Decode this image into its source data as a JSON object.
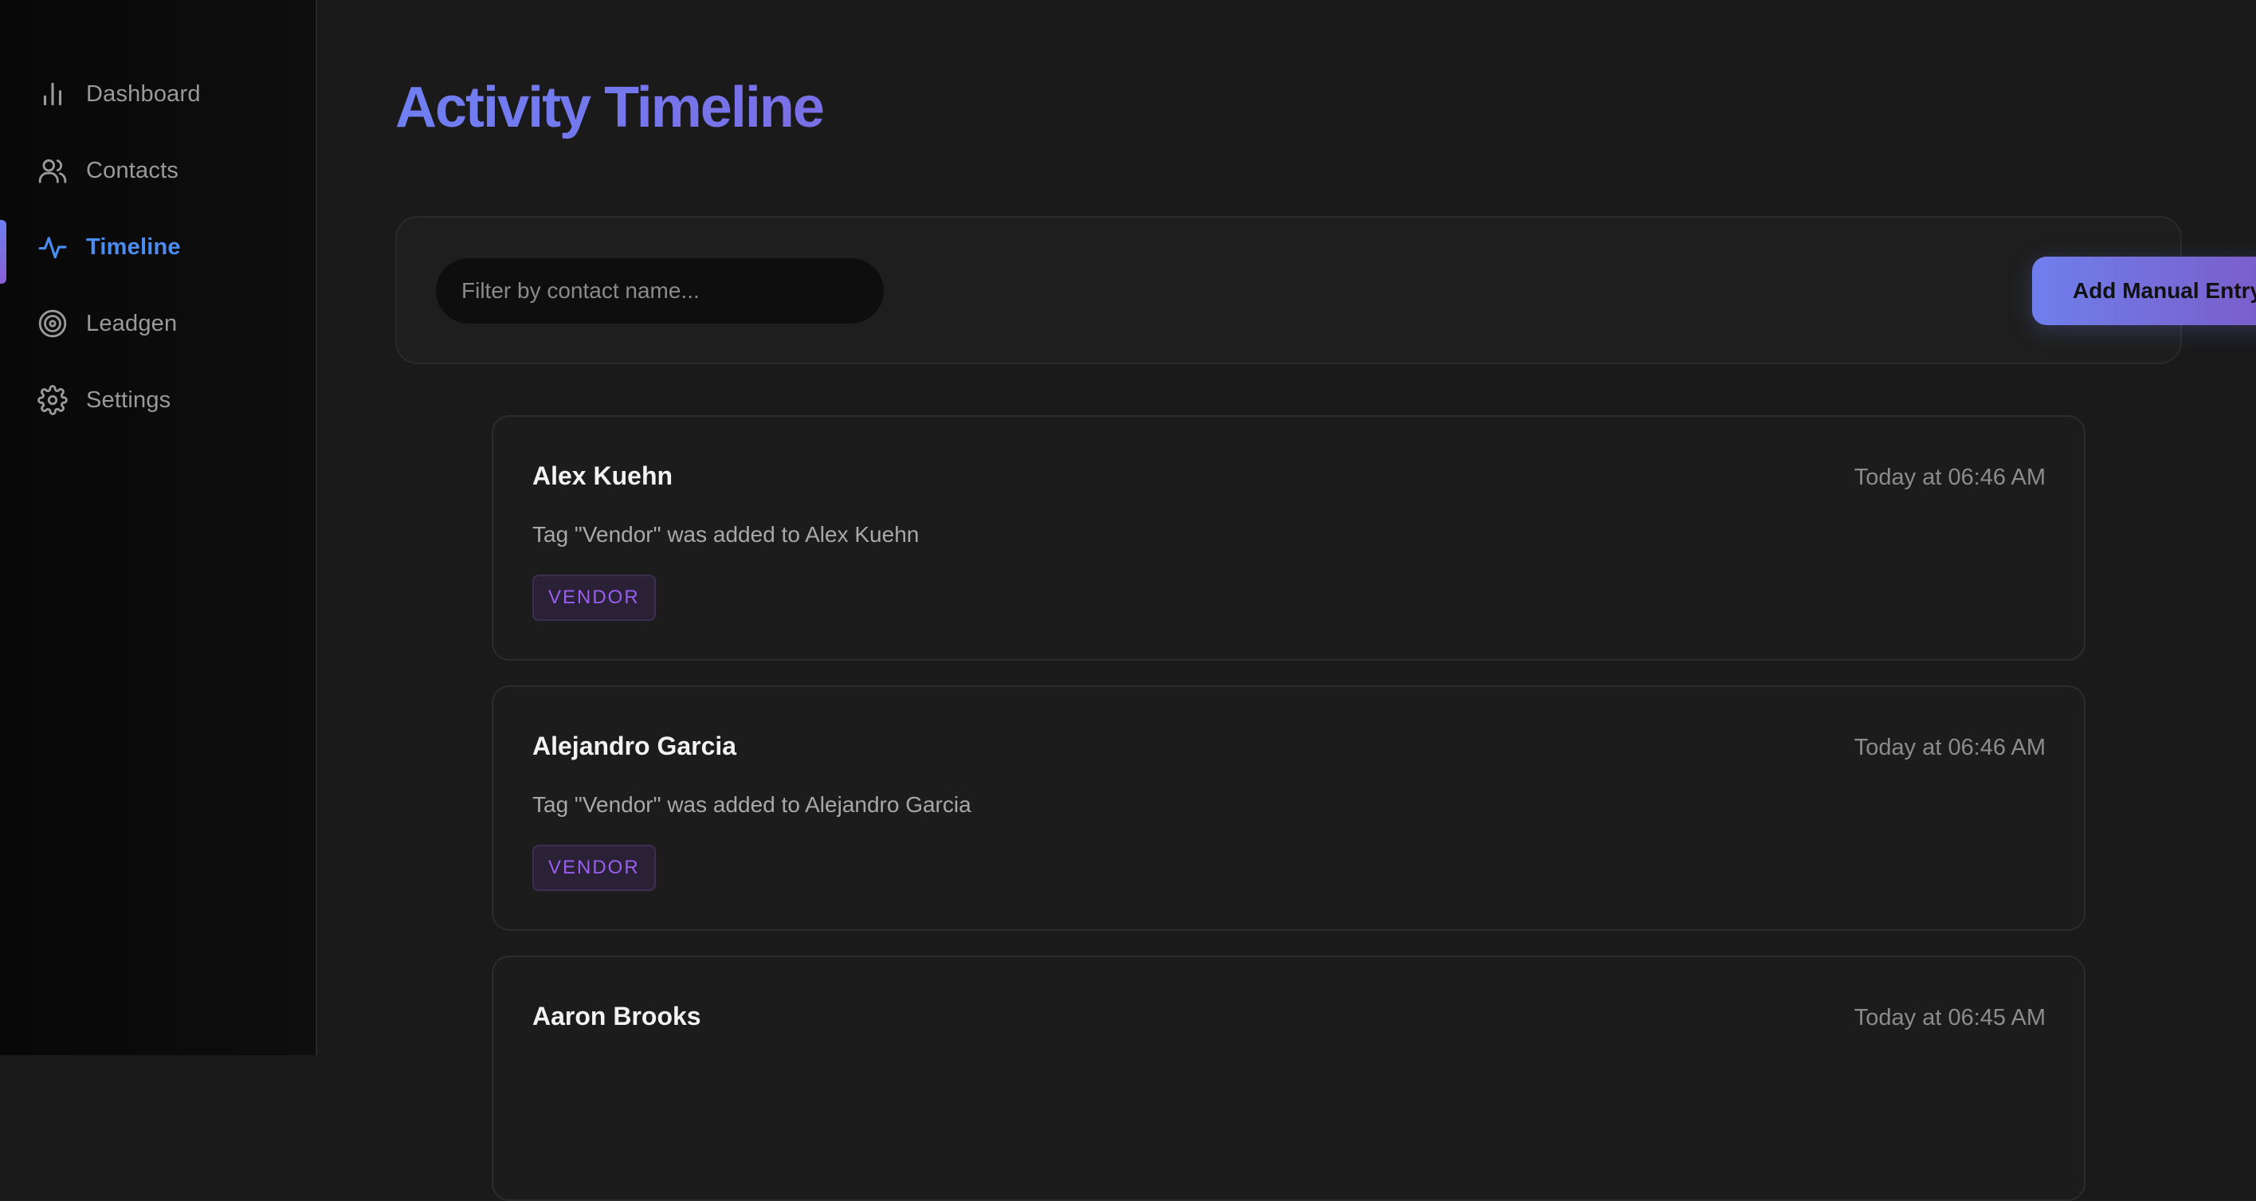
{
  "sidebar": {
    "items": [
      {
        "label": "Dashboard",
        "icon": "bar-chart-icon",
        "active": false
      },
      {
        "label": "Contacts",
        "icon": "users-icon",
        "active": false
      },
      {
        "label": "Timeline",
        "icon": "activity-icon",
        "active": true
      },
      {
        "label": "Leadgen",
        "icon": "target-icon",
        "active": false
      },
      {
        "label": "Settings",
        "icon": "gear-icon",
        "active": false
      }
    ]
  },
  "main": {
    "title": "Activity Timeline",
    "toolbar": {
      "search_placeholder": "Filter by contact name...",
      "search_value": "",
      "add_label": "Add Manual Entry"
    },
    "entries": [
      {
        "name": "Alex Kuehn",
        "time": "Today at 06:46 AM",
        "description": "Tag \"Vendor\" was added to Alex Kuehn",
        "tag": "VENDOR"
      },
      {
        "name": "Alejandro Garcia",
        "time": "Today at 06:46 AM",
        "description": "Tag \"Vendor\" was added to Alejandro Garcia",
        "tag": "VENDOR"
      },
      {
        "name": "Aaron Brooks",
        "time": "Today at 06:45 AM",
        "description": "",
        "tag": ""
      }
    ]
  },
  "colors": {
    "accent": "#4b8cf0",
    "title_gradient_start": "#6f7ff2",
    "button_gradient_start": "#6f7fec",
    "button_gradient_end": "#7c58c4",
    "tag_text": "#9a5ef0"
  }
}
